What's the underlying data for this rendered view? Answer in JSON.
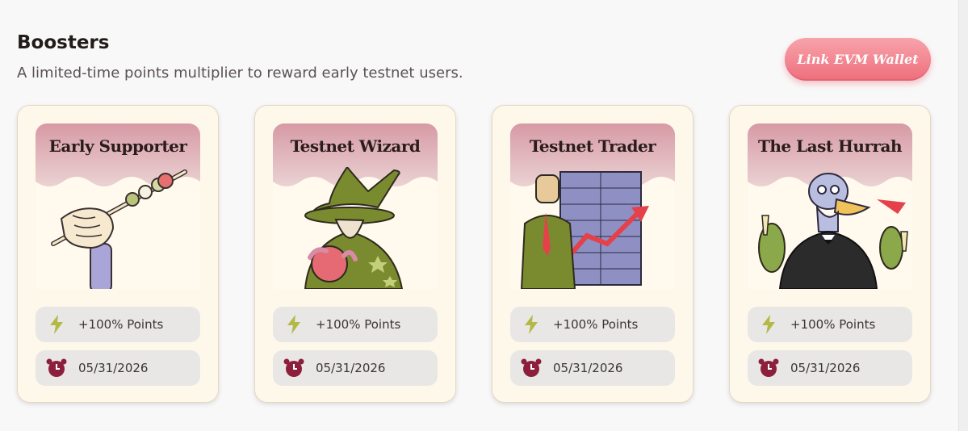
{
  "header": {
    "title": "Boosters",
    "subtitle": "A limited-time points multiplier to reward early testnet users.",
    "link_wallet_label": "Link EVM Wallet"
  },
  "colors": {
    "accent_button": "#ee6f7c",
    "card_bg": "#fef8eb",
    "banner_pink": "#d9a1ab",
    "bolt": "#b3b846",
    "clock": "#8c1f3c"
  },
  "cards": [
    {
      "title": "Early Supporter",
      "points": "+100% Points",
      "date": "05/31/2026",
      "art_icon": "hand-skewer-illustration"
    },
    {
      "title": "Testnet Wizard",
      "points": "+100% Points",
      "date": "05/31/2026",
      "art_icon": "wizard-illustration"
    },
    {
      "title": "Testnet Trader",
      "points": "+100% Points",
      "date": "05/31/2026",
      "art_icon": "trader-chart-illustration"
    },
    {
      "title": "The Last Hurrah",
      "points": "+100% Points",
      "date": "05/31/2026",
      "art_icon": "party-ostrich-illustration"
    }
  ],
  "icons": {
    "points": "lightning-bolt-icon",
    "date": "alarm-clock-icon"
  }
}
